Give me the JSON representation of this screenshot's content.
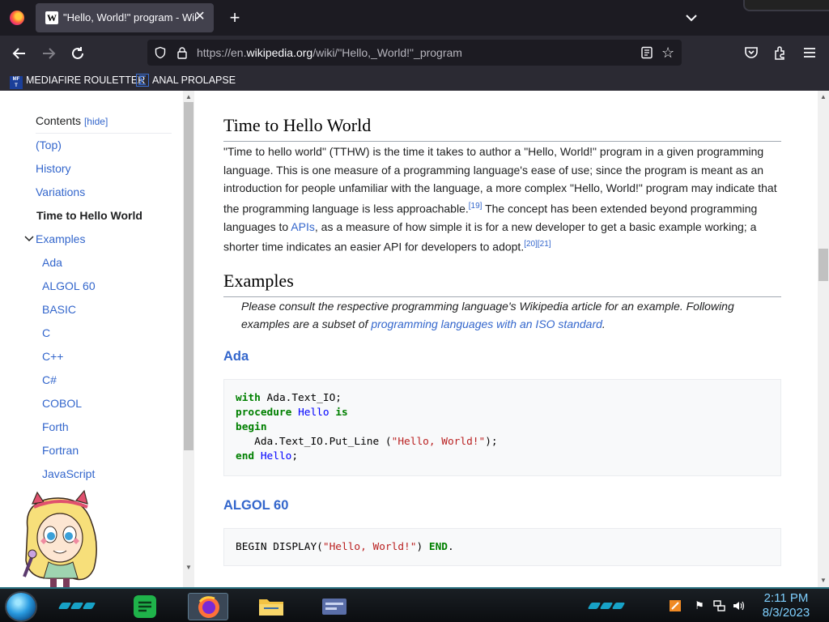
{
  "browser": {
    "tab_title": "\"Hello, World!\" program - Wiki",
    "tab_close": "✕",
    "new_tab": "+",
    "url_prefix": "https://en.",
    "url_domain": "wikipedia.org",
    "url_path": "/wiki/\"Hello,_World!\"_program",
    "bookmarks": [
      "MEDIAFIRE ROULETTER",
      "ANAL PROLAPSE"
    ],
    "bookmark_icon_text": "MF\nT"
  },
  "toc": {
    "heading": "Contents",
    "hide_label": "[hide]",
    "items": [
      {
        "label": "(Top)"
      },
      {
        "label": "History"
      },
      {
        "label": "Variations"
      },
      {
        "label": "Time to Hello World",
        "active": true
      },
      {
        "label": "Examples",
        "expanded": true
      },
      {
        "label": "Ada"
      },
      {
        "label": "ALGOL 60"
      },
      {
        "label": "BASIC"
      },
      {
        "label": "C"
      },
      {
        "label": "C++"
      },
      {
        "label": "C#"
      },
      {
        "label": "COBOL"
      },
      {
        "label": "Forth"
      },
      {
        "label": "Fortran"
      },
      {
        "label": "JavaScript"
      }
    ]
  },
  "article": {
    "section1_title": "Time to Hello World",
    "section1_p1": "\"Time to hello world\" (TTHW) is the time it takes to author a \"Hello, World!\" program in a given programming language. This is one measure of a programming language's ease of use; since the program is meant as an introduction for people unfamiliar with the language, a more complex \"Hello, World!\" program may indicate that the programming language is less approachable.",
    "ref19": "[19]",
    "section1_p2a": " The concept has been extended beyond programming languages to ",
    "apis_link": "APIs",
    "section1_p2b": ", as a measure of how simple it is for a new developer to get a basic example working; a shorter time indicates an easier API for developers to adopt.",
    "ref20": "[20]",
    "ref21": "[21]",
    "section2_title": "Examples",
    "hatnote_a": "Please consult the respective programming language's Wikipedia article for an example. Following examples are a subset of ",
    "hatnote_link": "programming languages with an ISO standard",
    "hatnote_b": ".",
    "ada_title": "Ada",
    "ada_code": {
      "l1_kw": "with",
      "l1_rest": " Ada.Text_IO;",
      "l2_kw": "procedure",
      "l2_fn": "Hello",
      "l2_kw2": "is",
      "l3_kw": "begin",
      "l4_pre": "   Ada.Text_IO.Put_Line (",
      "l4_str": "\"Hello, World!\"",
      "l4_post": ");",
      "l5_kw": "end",
      "l5_fn": "Hello",
      "l5_post": ";"
    },
    "algol_title": "ALGOL 60",
    "algol_code": {
      "pre": "BEGIN DISPLAY(",
      "str": "\"Hello, World!\"",
      "post": ") ",
      "kw": "END",
      "end": "."
    }
  },
  "taskbar": {
    "time": "2:11 PM",
    "date": "8/3/2023"
  },
  "colors": {
    "link": "#3366cc",
    "code_keyword": "#008000",
    "code_string": "#ba2121",
    "clock": "#7fd0ff"
  }
}
